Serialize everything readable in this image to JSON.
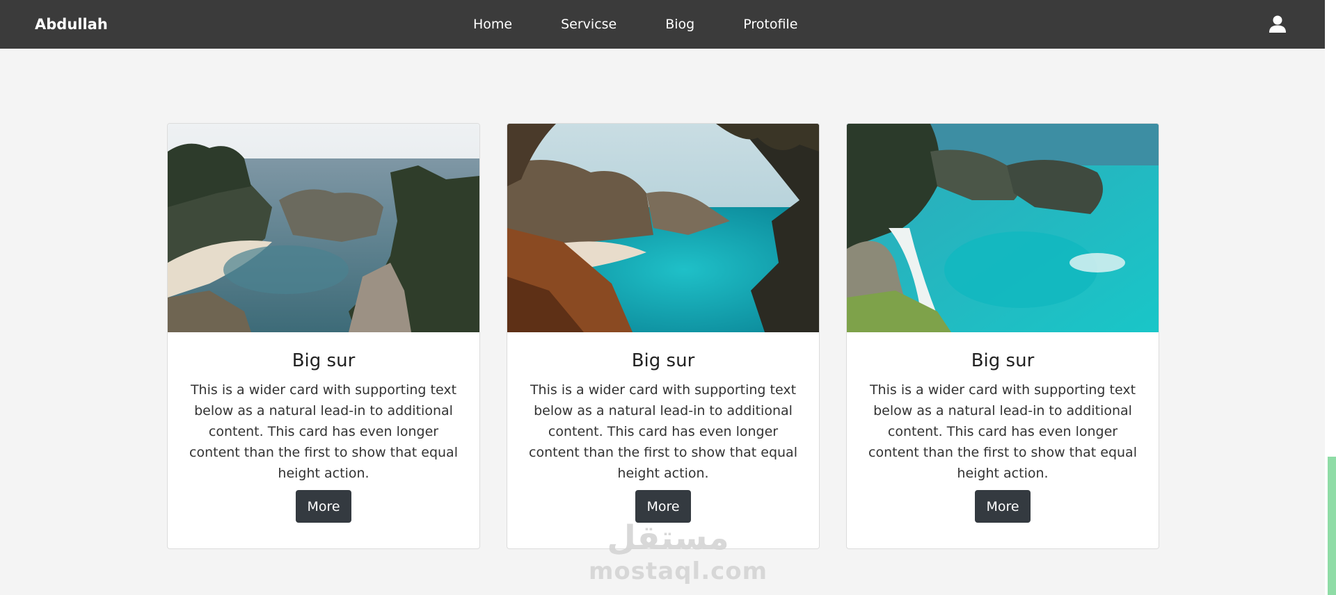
{
  "navbar": {
    "brand": "Abdullah",
    "links": [
      {
        "label": "Home"
      },
      {
        "label": "Servicse"
      },
      {
        "label": "Biog"
      },
      {
        "label": "Protofile"
      }
    ],
    "user_icon": "user-icon",
    "background": "#3b3b3b"
  },
  "cards": [
    {
      "image": "big-sur-cove-photo",
      "title": "Big sur",
      "text": "This is a wider card with supporting text below as a natural lead-in to additional content. This card has even longer content than the first to show that equal height action.",
      "button": "More"
    },
    {
      "image": "big-sur-cove-through-trees-photo",
      "title": "Big sur",
      "text": "This is a wider card with supporting text below as a natural lead-in to additional content. This card has even longer content than the first to show that equal height action.",
      "button": "More"
    },
    {
      "image": "big-sur-turquoise-cove-photo",
      "title": "Big sur",
      "text": "This is a wider card with supporting text below as a natural lead-in to additional content. This card has even longer content than the first to show that equal height action.",
      "button": "More"
    }
  ],
  "watermark": {
    "arabic": "مستقل",
    "latin": "mostaql.com"
  },
  "colors": {
    "page_background": "#f4f4f4",
    "button": "#343a40",
    "scroll_accent": "#8fdca6"
  }
}
